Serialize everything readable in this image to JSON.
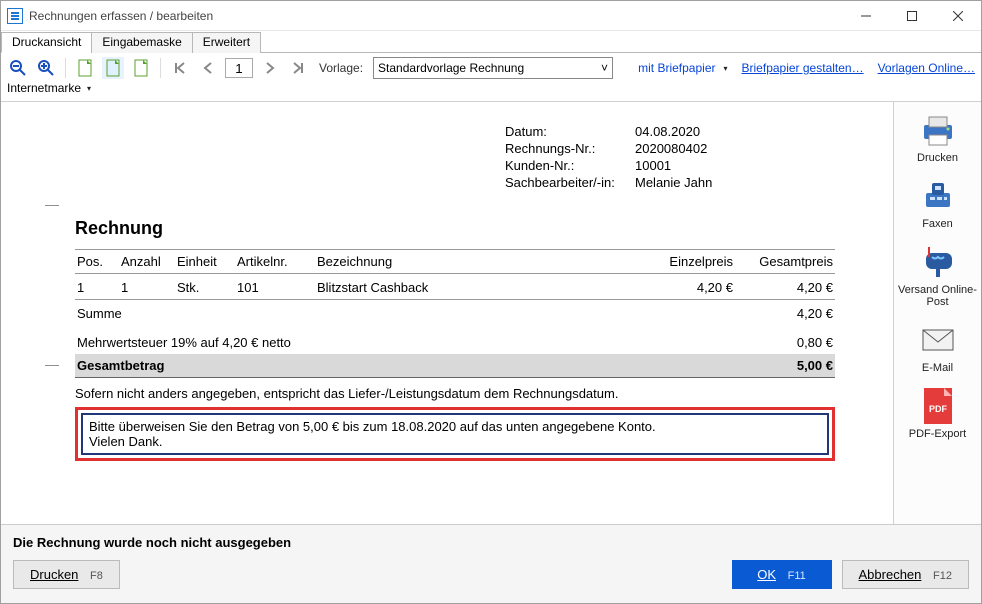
{
  "window": {
    "title": "Rechnungen erfassen / bearbeiten"
  },
  "tabs": {
    "t0": "Druckansicht",
    "t1": "Eingabemaske",
    "t2": "Erweitert"
  },
  "toolbar": {
    "page_number": "1",
    "template_label": "Vorlage:",
    "template_value": "Standardvorlage Rechnung",
    "letterhead_link": "mit Briefpapier",
    "design_link": "Briefpapier gestalten…",
    "online_link": "Vorlagen Online…",
    "internet_stamp": "Internetmarke"
  },
  "doc": {
    "meta": {
      "date_label": "Datum:",
      "date_value": "04.08.2020",
      "invno_label": "Rechnungs-Nr.:",
      "invno_value": "2020080402",
      "custno_label": "Kunden-Nr.:",
      "custno_value": "10001",
      "clerk_label": "Sachbearbeiter/-in:",
      "clerk_value": "Melanie Jahn"
    },
    "title": "Rechnung",
    "cols": {
      "pos": "Pos.",
      "qty": "Anzahl",
      "unit": "Einheit",
      "art": "Artikelnr.",
      "desc": "Bezeichnung",
      "unitp": "Einzelpreis",
      "total": "Gesamtpreis"
    },
    "row": {
      "pos": "1",
      "qty": "1",
      "unit": "Stk.",
      "art": "101",
      "desc": "Blitzstart Cashback",
      "unitp": "4,20 €",
      "total": "4,20 €"
    },
    "sum_label": "Summe",
    "sum_value": "4,20 €",
    "vat_label": "Mehrwertsteuer 19% auf 4,20 € netto",
    "vat_value": "0,80 €",
    "grand_label": "Gesamtbetrag",
    "grand_value": "5,00 €",
    "delivery_note": "Sofern nicht anders angegeben, entspricht das Liefer-/Leistungsdatum dem Rechnungsdatum.",
    "payment_line1": "Bitte überweisen Sie den Betrag von 5,00 € bis zum 18.08.2020 auf das unten angegebene Konto.",
    "payment_line2": "Vielen Dank."
  },
  "side": {
    "print": "Drucken",
    "fax": "Faxen",
    "post": "Versand Online-Post",
    "email": "E-Mail",
    "pdf": "PDF-Export"
  },
  "footer": {
    "status": "Die Rechnung wurde noch nicht ausgegeben",
    "print_btn": "Drucken",
    "print_key": "F8",
    "ok_btn": "OK",
    "ok_key": "F11",
    "cancel_btn": "Abbrechen",
    "cancel_key": "F12"
  }
}
